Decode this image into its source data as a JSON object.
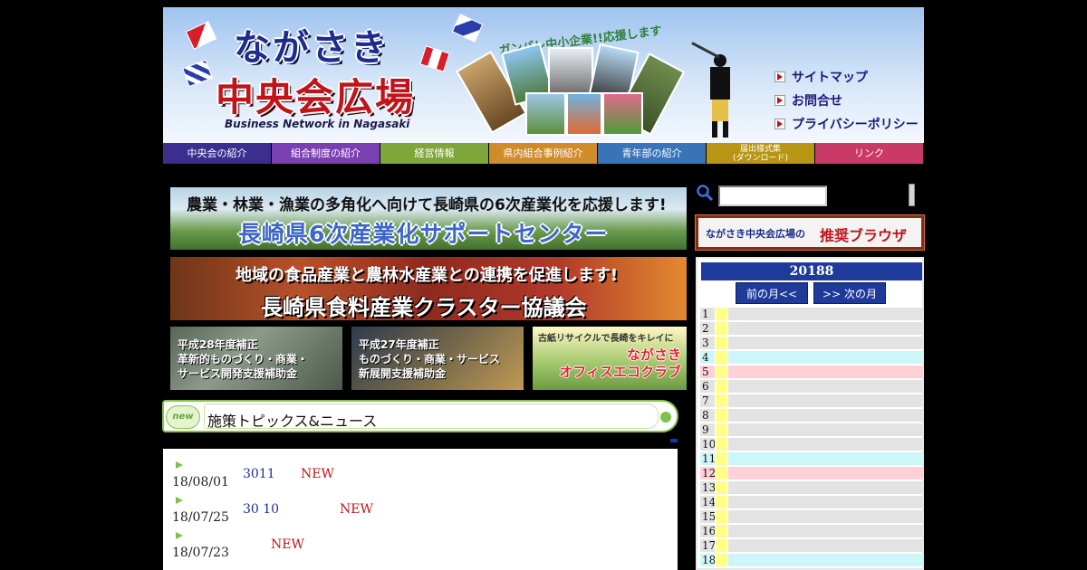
{
  "header": {
    "logo_line1": "ながさき",
    "logo_line2": "中央会広場",
    "logo_sub": "Business Network in Nagasaki",
    "fan_tag": "ガンバレ中小企業!!応援します",
    "links": [
      "サイトマップ",
      "お問合せ",
      "プライバシーポリシー"
    ]
  },
  "nav": [
    {
      "label": "中央会の紹介",
      "color": "#3b2e8f"
    },
    {
      "label": "組合制度の紹介",
      "color": "#7a3fb0"
    },
    {
      "label": "経営情報",
      "color": "#7fa63a"
    },
    {
      "label": "県内組合事例紹介",
      "color": "#d08b2a"
    },
    {
      "label": "青年部の紹介",
      "color": "#3a74b8"
    },
    {
      "label": "届出様式集\n(ダウンロード)",
      "color": "#b89614"
    },
    {
      "label": "リンク",
      "color": "#c93a66"
    }
  ],
  "banners": {
    "b1_line1": "農業・林業・漁業の多角化へ向けて長崎県の6次産業化を応援します!",
    "b1_line2": "長崎県6次産業化サポートセンター",
    "b2_line1": "地域の食品産業と農林水産業との連携を促進します!",
    "b2_line2": "長崎県食料産業クラスター協議会",
    "b3": [
      "平成28年度補正",
      "革新的ものづくり・商業・",
      "サービス開発支援補助金"
    ],
    "b4": [
      "平成27年度補正",
      "ものづくり・商業・サービス",
      "新展開支援補助金"
    ],
    "b5_top": "古紙リサイクルで長崎をキレイに",
    "b5": [
      "ながさき",
      "オフィスエコクラブ"
    ]
  },
  "news": {
    "badge": "new",
    "title": "施策トピックス&ニュース",
    "items": [
      {
        "date": "18/08/01",
        "text": "3011",
        "new": "NEW"
      },
      {
        "date": "18/07/25",
        "text": "30 10",
        "new": "NEW"
      },
      {
        "date": "18/07/23",
        "text": "",
        "new": "NEW"
      }
    ]
  },
  "search": {
    "value": ""
  },
  "browser": {
    "prefix": "ながさき中央会広場の",
    "emph": "推奨ブラウザ"
  },
  "calendar": {
    "title": "20188",
    "prev": "前の月<<",
    "next": ">> 次の月",
    "days": [
      {
        "n": "1",
        "color": "#e3e3e3"
      },
      {
        "n": "2",
        "color": "#e3e3e3"
      },
      {
        "n": "3",
        "color": "#e3e3e3"
      },
      {
        "n": "4",
        "color": "#cdf6f8"
      },
      {
        "n": "5",
        "color": "#ffd0d6"
      },
      {
        "n": "6",
        "color": "#e3e3e3"
      },
      {
        "n": "7",
        "color": "#e3e3e3"
      },
      {
        "n": "8",
        "color": "#e3e3e3"
      },
      {
        "n": "9",
        "color": "#e3e3e3"
      },
      {
        "n": "10",
        "color": "#e3e3e3"
      },
      {
        "n": "11",
        "color": "#cdf6f8"
      },
      {
        "n": "12",
        "color": "#ffd0d6"
      },
      {
        "n": "13",
        "color": "#e3e3e3"
      },
      {
        "n": "14",
        "color": "#e3e3e3"
      },
      {
        "n": "15",
        "color": "#e3e3e3"
      },
      {
        "n": "16",
        "color": "#e3e3e3"
      },
      {
        "n": "17",
        "color": "#e3e3e3"
      },
      {
        "n": "18",
        "color": "#cdf6f8"
      }
    ]
  }
}
